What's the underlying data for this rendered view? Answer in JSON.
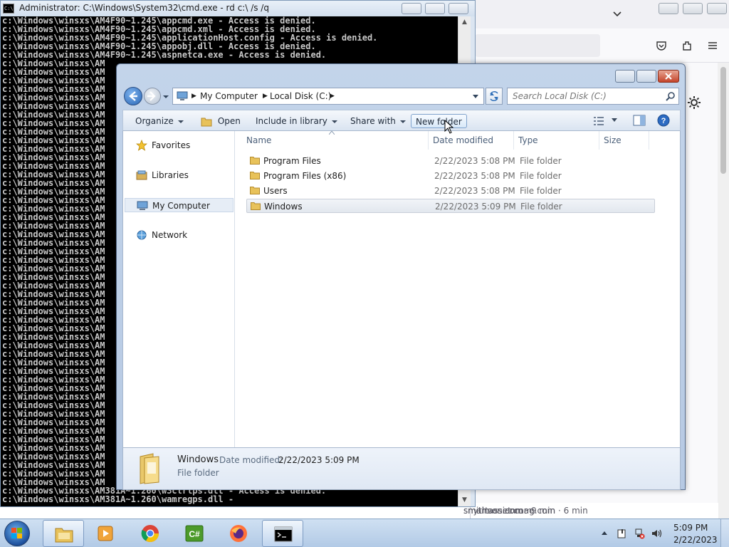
{
  "cmd": {
    "title": "Administrator: C:\\Windows\\System32\\cmd.exe - rd  c:\\ /s /q",
    "icon_text": "C:\\",
    "lines_top": [
      "c:\\Windows\\winsxs\\AM4F90~1.245\\appcmd.exe - Access is denied.",
      "c:\\Windows\\winsxs\\AM4F90~1.245\\appcmd.xml - Access is denied.",
      "c:\\Windows\\winsxs\\AM4F90~1.245\\applicationHost.config - Access is denied.",
      "c:\\Windows\\winsxs\\AM4F90~1.245\\appobj.dll - Access is denied.",
      "c:\\Windows\\winsxs\\AM4F90~1.245\\aspnetca.exe - Access is denied."
    ],
    "line_partial": "c:\\Windows\\winsxs\\AM",
    "lines_bottom": [
      "c:\\Windows\\winsxs\\AM381A~1.260\\w3ctrlps.dll - Access is denied.",
      "c:\\Windows\\winsxs\\AM381A~1.260\\wamregps.dll -"
    ]
  },
  "explorer": {
    "breadcrumbs": [
      "My Computer",
      "Local Disk (C:)"
    ],
    "search_placeholder": "Search Local Disk (C:)",
    "toolbar": {
      "organize": "Organize",
      "open": "Open",
      "include": "Include in library",
      "share": "Share with",
      "new_folder": "New folder"
    },
    "nav": [
      {
        "label": "Favorites",
        "icon": "star-icon"
      },
      {
        "label": "Libraries",
        "icon": "libraries-icon"
      },
      {
        "label": "My Computer",
        "icon": "computer-icon"
      },
      {
        "label": "Network",
        "icon": "network-icon"
      }
    ],
    "columns": [
      "Name",
      "Date modified",
      "Type",
      "Size"
    ],
    "files": [
      {
        "name": "Program Files",
        "date": "2/22/2023 5:08 PM",
        "type": "File folder"
      },
      {
        "name": "Program Files (x86)",
        "date": "2/22/2023 5:08 PM",
        "type": "File folder"
      },
      {
        "name": "Users",
        "date": "2/22/2023 5:08 PM",
        "type": "File folder"
      },
      {
        "name": "Windows",
        "date": "2/22/2023 5:09 PM",
        "type": "File folder"
      }
    ],
    "details": {
      "name": "Windows",
      "modified_label": "Date modified:",
      "modified_value": "2/22/2023 5:09 PM",
      "type": "File folder"
    }
  },
  "browser": {
    "bottom_links": [
      "nytimes.com · 9 min",
      "smartasset.com",
      "smithsonianmag.com · 6 min"
    ]
  },
  "taskbar": {
    "apps": [
      "explorer-icon",
      "media-player-icon",
      "chrome-icon",
      "csharp-icon",
      "firefox-icon",
      "cmd-icon"
    ],
    "time": "5:09 PM",
    "date": "2/22/2023"
  },
  "colors": {
    "console_bg": "#000000",
    "console_text": "#c8c8c8",
    "aero_frame": "#c3d4ea",
    "folder_yellow": "#e8c25a"
  }
}
